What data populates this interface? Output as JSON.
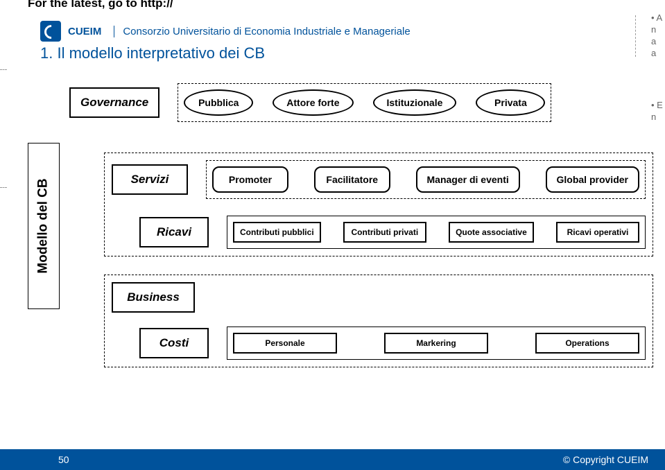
{
  "topText": "For the latest, go to http://",
  "header": {
    "brand": "CUEIM",
    "subtitle": "Consorzio Universitario di Economia Industriale e Manageriale"
  },
  "slideTitle": "1. Il modello interpretativo dei CB",
  "sidebarLabel": "Modello del CB",
  "rows": {
    "governance": {
      "label": "Governance",
      "items": [
        "Pubblica",
        "Attore forte",
        "Istituzionale",
        "Privata"
      ]
    },
    "servizi": {
      "label": "Servizi",
      "items": [
        "Promoter",
        "Facilitatore",
        "Manager di eventi",
        "Global provider"
      ]
    },
    "ricavi": {
      "label": "Ricavi",
      "items": [
        "Contributi pubblici",
        "Contributi privati",
        "Quote associative",
        "Ricavi operativi"
      ]
    },
    "business": {
      "label": "Business"
    },
    "costi": {
      "label": "Costi",
      "items": [
        "Personale",
        "Markering",
        "Operations"
      ]
    }
  },
  "footer": {
    "pageNumber": "50",
    "copyright": "© Copyright  CUEIM"
  },
  "sideHints": [
    "• A",
    "n",
    "a",
    "a",
    "• E",
    "n"
  ]
}
